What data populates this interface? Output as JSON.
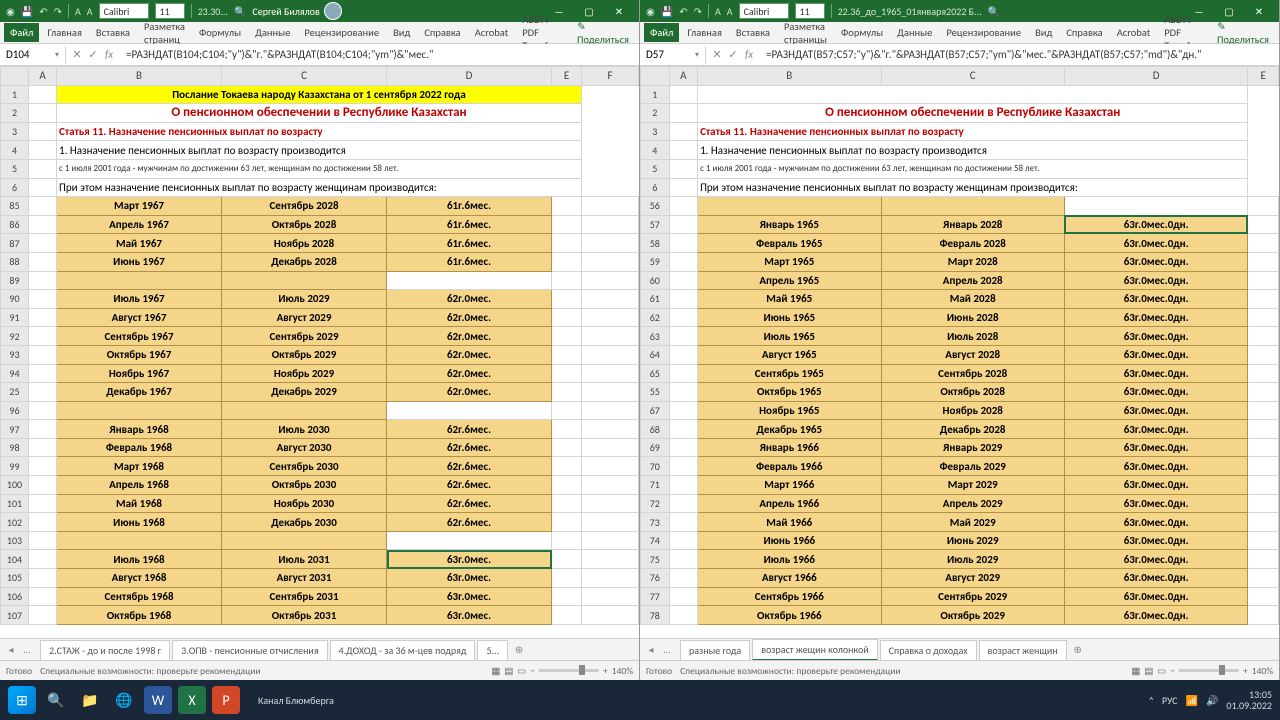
{
  "left": {
    "user": "Сергей Билялов",
    "titleFile": "23.30...",
    "font": "Calibri",
    "ribbonTabs": [
      "Файл",
      "Главная",
      "Вставка",
      "Разметка страниц",
      "Формулы",
      "Данные",
      "Рецензирование",
      "Вид",
      "Справка",
      "Acrobat",
      "ABBYY PDF Transfor"
    ],
    "share": "Поделиться",
    "cellRef": "D104",
    "formula": "=РАЗНДАТ(B104;C104;\"y\")&\"г.\"&РАЗНДАТ(B104;C104;\"ym\")&\"мес.\"",
    "cols": [
      "A",
      "B",
      "C",
      "D",
      "E",
      "F"
    ],
    "h1": "Послание Токаева народу Казахстана от 1 сентября 2022 года",
    "h2": "О пенсионном обеспечении в Республике Казахстан",
    "h3": "Статья 11. Назначение пенсионных выплат по возрасту",
    "h4": "1. Назначение пенсионных выплат по возрасту производится",
    "h5": "с 1 июля 2001 года - мужчинам по достижении 63 лет, женщинам по достижении 58 лет.",
    "h6": "При этом назначение пенсионных выплат по возрасту женщинам производится:",
    "rows": [
      {
        "r": "85",
        "b": "Март 1967",
        "c": "Сентябрь 2028",
        "d": "61г.6мес."
      },
      {
        "r": "86",
        "b": "Апрель 1967",
        "c": "Октябрь 2028",
        "d": "61г.6мес."
      },
      {
        "r": "87",
        "b": "Май 1967",
        "c": "Ноябрь 2028",
        "d": "61г.6мес."
      },
      {
        "r": "88",
        "b": "Июнь 1967",
        "c": "Декабрь 2028",
        "d": "61г.6мес."
      },
      {
        "r": "89",
        "b": "",
        "c": "",
        "d": ""
      },
      {
        "r": "90",
        "b": "Июль 1967",
        "c": "Июль 2029",
        "d": "62г.0мес."
      },
      {
        "r": "91",
        "b": "Август 1967",
        "c": "Август 2029",
        "d": "62г.0мес."
      },
      {
        "r": "92",
        "b": "Сентябрь 1967",
        "c": "Сентябрь 2029",
        "d": "62г.0мес."
      },
      {
        "r": "93",
        "b": "Октябрь 1967",
        "c": "Октябрь 2029",
        "d": "62г.0мес."
      },
      {
        "r": "94",
        "b": "Ноябрь 1967",
        "c": "Ноябрь 2029",
        "d": "62г.0мес."
      },
      {
        "r": "25",
        "b": "Декабрь 1967",
        "c": "Декабрь 2029",
        "d": "62г.0мес."
      },
      {
        "r": "96",
        "b": "",
        "c": "",
        "d": ""
      },
      {
        "r": "97",
        "b": "Январь 1968",
        "c": "Июль 2030",
        "d": "62г.6мес."
      },
      {
        "r": "98",
        "b": "Февраль 1968",
        "c": "Август 2030",
        "d": "62г.6мес."
      },
      {
        "r": "99",
        "b": "Март 1968",
        "c": "Сентябрь 2030",
        "d": "62г.6мес."
      },
      {
        "r": "100",
        "b": "Апрель 1968",
        "c": "Октябрь 2030",
        "d": "62г.6мес."
      },
      {
        "r": "101",
        "b": "Май 1968",
        "c": "Ноябрь 2030",
        "d": "62г.6мес."
      },
      {
        "r": "102",
        "b": "Июнь 1968",
        "c": "Декабрь 2030",
        "d": "62г.6мес."
      },
      {
        "r": "103",
        "b": "",
        "c": "",
        "d": ""
      },
      {
        "r": "104",
        "b": "Июль 1968",
        "c": "Июль 2031",
        "d": "63г.0мес.",
        "sel": true
      },
      {
        "r": "105",
        "b": "Август 1968",
        "c": "Август 2031",
        "d": "63г.0мес."
      },
      {
        "r": "106",
        "b": "Сентябрь 1968",
        "c": "Сентябрь 2031",
        "d": "63г.0мес."
      },
      {
        "r": "107",
        "b": "Октябрь 1968",
        "c": "Октябрь 2031",
        "d": "63г.0мес."
      }
    ],
    "sheetTabs": [
      "2.СТАЖ - до и после 1998 г",
      "3.ОПВ - пенсионные отчисления",
      "4.ДОХОД - за 36 м-цев подряд",
      "5..."
    ],
    "statusText": "Готово",
    "statusHint": "Специальные возможности: проверьте рекомендации",
    "zoom": "140%"
  },
  "right": {
    "titleFile": "22.36_до_1965_01января2022 Б...",
    "font": "Calibri",
    "ribbonTabs": [
      "Файл",
      "Главная",
      "Вставка",
      "Разметка страницы",
      "Формулы",
      "Данные",
      "Рецензирование",
      "Вид",
      "Справка",
      "Acrobat",
      "ABBYY PDF Transfo"
    ],
    "share": "Поделиться",
    "cellRef": "D57",
    "formula": "=РАЗНДАТ(B57;C57;\"y\")&\"г.\"&РАЗНДАТ(B57;C57;\"ym\")&\"мес.\"&РАЗНДАТ(B57;C57;\"md\")&\"дн.\"",
    "cols": [
      "A",
      "B",
      "C",
      "D",
      "E"
    ],
    "h2": "О пенсионном обеспечении в Республике Казахстан",
    "h3": "Статья 11. Назначение пенсионных выплат по возрасту",
    "h4": "1. Назначение пенсионных выплат по возрасту производится",
    "h5": "с 1 июля 2001 года - мужчинам по достижении 63 лет, женщинам по достижении 58 лет.",
    "h6": "При этом назначение пенсионных выплат по возрасту женщинам производится:",
    "rows": [
      {
        "r": "56",
        "b": "",
        "c": "",
        "d": ""
      },
      {
        "r": "57",
        "b": "Январь 1965",
        "c": "Январь 2028",
        "d": "63г.0мес.0дн.",
        "sel": true
      },
      {
        "r": "58",
        "b": "Февраль 1965",
        "c": "Февраль 2028",
        "d": "63г.0мес.0дн."
      },
      {
        "r": "59",
        "b": "Март 1965",
        "c": "Март 2028",
        "d": "63г.0мес.0дн."
      },
      {
        "r": "60",
        "b": "Апрель 1965",
        "c": "Апрель 2028",
        "d": "63г.0мес.0дн."
      },
      {
        "r": "61",
        "b": "Май 1965",
        "c": "Май 2028",
        "d": "63г.0мес.0дн."
      },
      {
        "r": "62",
        "b": "Июнь 1965",
        "c": "Июнь 2028",
        "d": "63г.0мес.0дн."
      },
      {
        "r": "63",
        "b": "Июль 1965",
        "c": "Июль 2028",
        "d": "63г.0мес.0дн."
      },
      {
        "r": "64",
        "b": "Август 1965",
        "c": "Август 2028",
        "d": "63г.0мес.0дн."
      },
      {
        "r": "65",
        "b": "Сентябрь 1965",
        "c": "Сентябрь 2028",
        "d": "63г.0мес.0дн."
      },
      {
        "r": "55",
        "b": "Октябрь 1965",
        "c": "Октябрь 2028",
        "d": "63г.0мес.0дн."
      },
      {
        "r": "67",
        "b": "Ноябрь 1965",
        "c": "Ноябрь 2028",
        "d": "63г.0мес.0дн."
      },
      {
        "r": "68",
        "b": "Декабрь 1965",
        "c": "Декабрь 2028",
        "d": "63г.0мес.0дн."
      },
      {
        "r": "69",
        "b": "Январь 1966",
        "c": "Январь 2029",
        "d": "63г.0мес.0дн."
      },
      {
        "r": "70",
        "b": "Февраль 1966",
        "c": "Февраль 2029",
        "d": "63г.0мес.0дн."
      },
      {
        "r": "71",
        "b": "Март 1966",
        "c": "Март 2029",
        "d": "63г.0мес.0дн."
      },
      {
        "r": "72",
        "b": "Апрель 1966",
        "c": "Апрель 2029",
        "d": "63г.0мес.0дн."
      },
      {
        "r": "73",
        "b": "Май 1966",
        "c": "Май 2029",
        "d": "63г.0мес.0дн."
      },
      {
        "r": "74",
        "b": "Июнь 1966",
        "c": "Июнь 2029",
        "d": "63г.0мес.0дн."
      },
      {
        "r": "75",
        "b": "Июль 1966",
        "c": "Июль 2029",
        "d": "63г.0мес.0дн."
      },
      {
        "r": "76",
        "b": "Август 1966",
        "c": "Август 2029",
        "d": "63г.0мес.0дн."
      },
      {
        "r": "77",
        "b": "Сентябрь 1966",
        "c": "Сентябрь 2029",
        "d": "63г.0мес.0дн."
      },
      {
        "r": "78",
        "b": "Октябрь 1966",
        "c": "Октябрь 2029",
        "d": "63г.0мес.0дн."
      }
    ],
    "sheetTabs": [
      "разные года",
      "возраст жещин колонкой",
      "Справка о доходах",
      "возраст женщин"
    ],
    "activeTab": 1,
    "statusText": "Готово",
    "statusHint": "Специальные возможности: проверьте рекомендации",
    "zoom": "140%"
  },
  "taskbar": {
    "time": "13:05",
    "date": "01.09.2022",
    "lang": "РУС",
    "channel": "Канал Блюмберга"
  }
}
